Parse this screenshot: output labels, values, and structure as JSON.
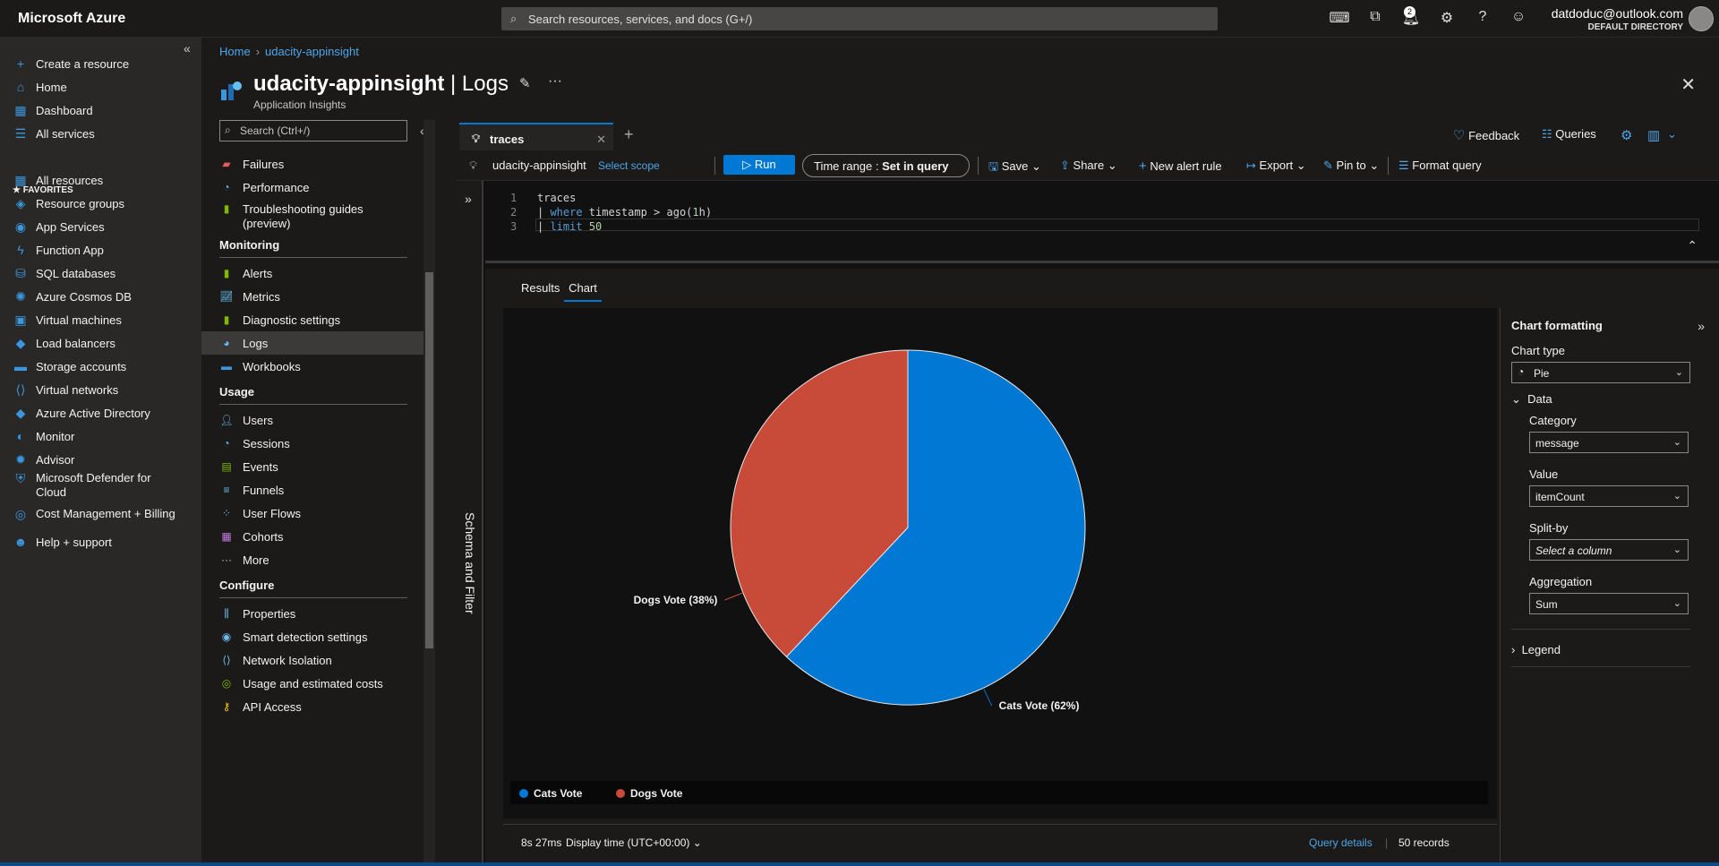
{
  "topbar": {
    "brand": "Microsoft Azure",
    "search_placeholder": "Search resources, services, and docs (G+/)",
    "notification_count": "2",
    "user_email": "datdoduc@outlook.com",
    "user_directory": "DEFAULT DIRECTORY"
  },
  "leftnav": {
    "favorites_label": "FAVORITES",
    "items": [
      {
        "label": "Create a resource",
        "icon": "plus-icon"
      },
      {
        "label": "Home",
        "icon": "home-icon"
      },
      {
        "label": "Dashboard",
        "icon": "dashboard-icon"
      },
      {
        "label": "All services",
        "icon": "list-icon"
      },
      {
        "label": "All resources",
        "icon": "grid-icon"
      },
      {
        "label": "Resource groups",
        "icon": "resource-group-icon"
      },
      {
        "label": "App Services",
        "icon": "app-service-icon"
      },
      {
        "label": "Function App",
        "icon": "function-icon"
      },
      {
        "label": "SQL databases",
        "icon": "sql-icon"
      },
      {
        "label": "Azure Cosmos DB",
        "icon": "cosmos-icon"
      },
      {
        "label": "Virtual machines",
        "icon": "vm-icon"
      },
      {
        "label": "Load balancers",
        "icon": "load-balancer-icon"
      },
      {
        "label": "Storage accounts",
        "icon": "storage-icon"
      },
      {
        "label": "Virtual networks",
        "icon": "vnet-icon"
      },
      {
        "label": "Azure Active Directory",
        "icon": "aad-icon"
      },
      {
        "label": "Monitor",
        "icon": "monitor-icon"
      },
      {
        "label": "Advisor",
        "icon": "advisor-icon"
      },
      {
        "label": "Microsoft Defender for Cloud",
        "icon": "shield-icon"
      },
      {
        "label": "Cost Management + Billing",
        "icon": "cost-icon"
      },
      {
        "label": "Help + support",
        "icon": "help-icon"
      }
    ]
  },
  "breadcrumb": {
    "home": "Home",
    "current": "udacity-appinsight"
  },
  "resource": {
    "name": "udacity-appinsight",
    "blade": "Logs",
    "type": "Application Insights"
  },
  "blade_menu": {
    "search_placeholder": "Search (Ctrl+/)",
    "items_top": [
      "Failures",
      "Performance",
      "Troubleshooting guides",
      "(preview)"
    ],
    "monitoring_title": "Monitoring",
    "monitoring": [
      "Alerts",
      "Metrics",
      "Diagnostic settings",
      "Logs",
      "Workbooks"
    ],
    "usage_title": "Usage",
    "usage": [
      "Users",
      "Sessions",
      "Events",
      "Funnels",
      "User Flows",
      "Cohorts",
      "More"
    ],
    "configure_title": "Configure",
    "configure": [
      "Properties",
      "Smart detection settings",
      "Network Isolation",
      "Usage and estimated costs",
      "API Access"
    ]
  },
  "query_tab": {
    "label": "traces"
  },
  "tab_actions": {
    "feedback": "Feedback",
    "queries": "Queries"
  },
  "toolbar": {
    "scope": "udacity-appinsight",
    "select_scope": "Select scope",
    "run": "Run",
    "time_range_label": "Time range : ",
    "time_range_value": "Set in query",
    "save": "Save",
    "share": "Share",
    "new_alert": "New alert rule",
    "export": "Export",
    "pin": "Pin to",
    "format": "Format query"
  },
  "schema_label": "Schema and Filter",
  "editor": {
    "line_numbers": [
      "1",
      "2",
      "3"
    ],
    "line1": "traces",
    "line2_kw": "where",
    "line2_rest": " timestamp > ago(",
    "line2_num": "1",
    "line2_end": "h)",
    "line3_kw": "limit",
    "line3_num": "50"
  },
  "results_tabs": {
    "results": "Results",
    "chart": "Chart"
  },
  "chart_data": {
    "type": "pie",
    "categories": [
      "Cats Vote",
      "Dogs Vote"
    ],
    "values": [
      62,
      38
    ],
    "labels": [
      "Cats Vote (62%)",
      "Dogs Vote (38%)"
    ],
    "colors": [
      "#0078d4",
      "#c84b3a"
    ],
    "legend": "bottom-left"
  },
  "status": {
    "duration": "8s 27ms",
    "display_time": "Display time (UTC+00:00)",
    "query_details": "Query details",
    "records": "50 records"
  },
  "formatting": {
    "title": "Chart formatting",
    "chart_type_label": "Chart type",
    "chart_type": "Pie",
    "data_section": "Data",
    "category_label": "Category",
    "category": "message",
    "value_label": "Value",
    "value": "itemCount",
    "split_label": "Split-by",
    "split": "Select a column",
    "aggregation_label": "Aggregation",
    "aggregation": "Sum",
    "legend_section": "Legend"
  }
}
